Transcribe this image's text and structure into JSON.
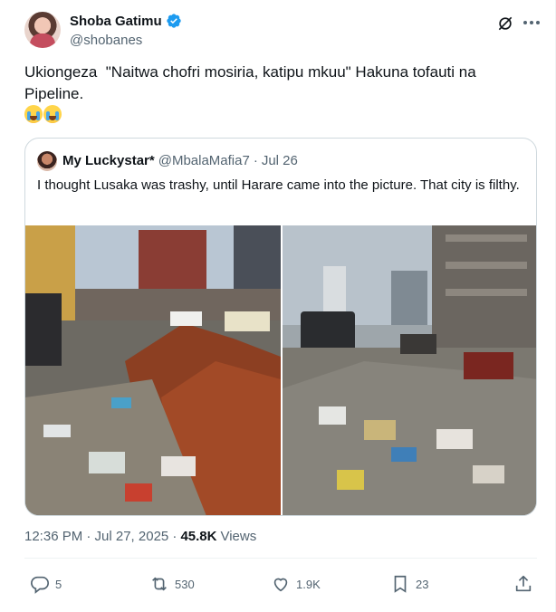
{
  "author": {
    "display_name": "Shoba Gatimu",
    "handle": "@shobanes",
    "verified": true
  },
  "tweet": {
    "text": "Ukiongeza  \"Naitwa chofri mosiria, katipu mkuu\" Hakuna tofauti na\nPipeline.",
    "emoji": [
      "😭",
      "😭"
    ]
  },
  "quoted": {
    "display_name": "My Luckystar*",
    "handle": "@MbalaMafia7",
    "separator": "·",
    "date": "Jul 26",
    "text": "I thought Lusaka was trashy, until Harare came into the picture. That city is filthy."
  },
  "meta": {
    "time": "12:36 PM · Jul 27, 2025 ·",
    "views_count": "45.8K",
    "views_label": "Views"
  },
  "actions": {
    "replies": "5",
    "reposts": "530",
    "likes": "1.9K",
    "bookmarks": "23"
  },
  "colors": {
    "text_primary": "#0f1419",
    "text_secondary": "#536471",
    "verified_blue": "#1d9bf0",
    "border": "#cfd9de"
  },
  "icons": [
    "verified-badge-icon",
    "grok-icon",
    "more-icon",
    "reply-icon",
    "repost-icon",
    "like-icon",
    "bookmark-icon",
    "share-icon"
  ]
}
